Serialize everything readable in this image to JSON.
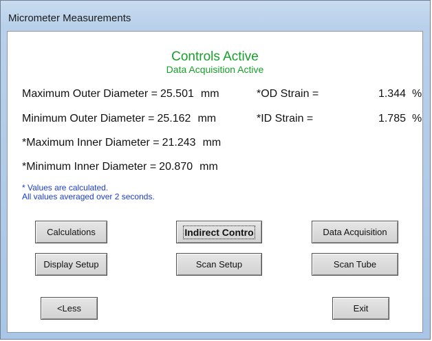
{
  "window": {
    "title": "Micrometer Measurements"
  },
  "status": {
    "controls": "Controls Active",
    "acquisition": "Data Acquisition Active"
  },
  "measurements": [
    {
      "label": "Maximum Outer Diameter =",
      "value": "25.501",
      "unit": "mm"
    },
    {
      "label": "Minimum Outer Diameter =",
      "value": "25.162",
      "unit": "mm"
    },
    {
      "label": "*Maximum Inner Diameter =",
      "value": "21.243",
      "unit": "mm"
    },
    {
      "label": "*Minimum Inner Diameter =",
      "value": "20.870",
      "unit": "mm"
    }
  ],
  "strain": [
    {
      "label": "*OD Strain =",
      "value": "1.344",
      "unit": "%"
    },
    {
      "label": "*ID Strain =",
      "value": "1.785",
      "unit": "%"
    }
  ],
  "notes": {
    "calculated": "* Values are calculated.",
    "averaged": "All values averaged over 2 seconds."
  },
  "buttons": {
    "calculations": "Calculations",
    "indirect_control": "Indirect Contro",
    "data_acquisition": "Data Acquisition",
    "display_setup": "Display Setup",
    "scan_setup": "Scan Setup",
    "scan_tube": "Scan Tube",
    "less": "<Less",
    "exit": "Exit"
  },
  "colors": {
    "status_text": "#15a02a",
    "note_text": "#1a3bd6",
    "window_frame": "#a9c6e6"
  }
}
